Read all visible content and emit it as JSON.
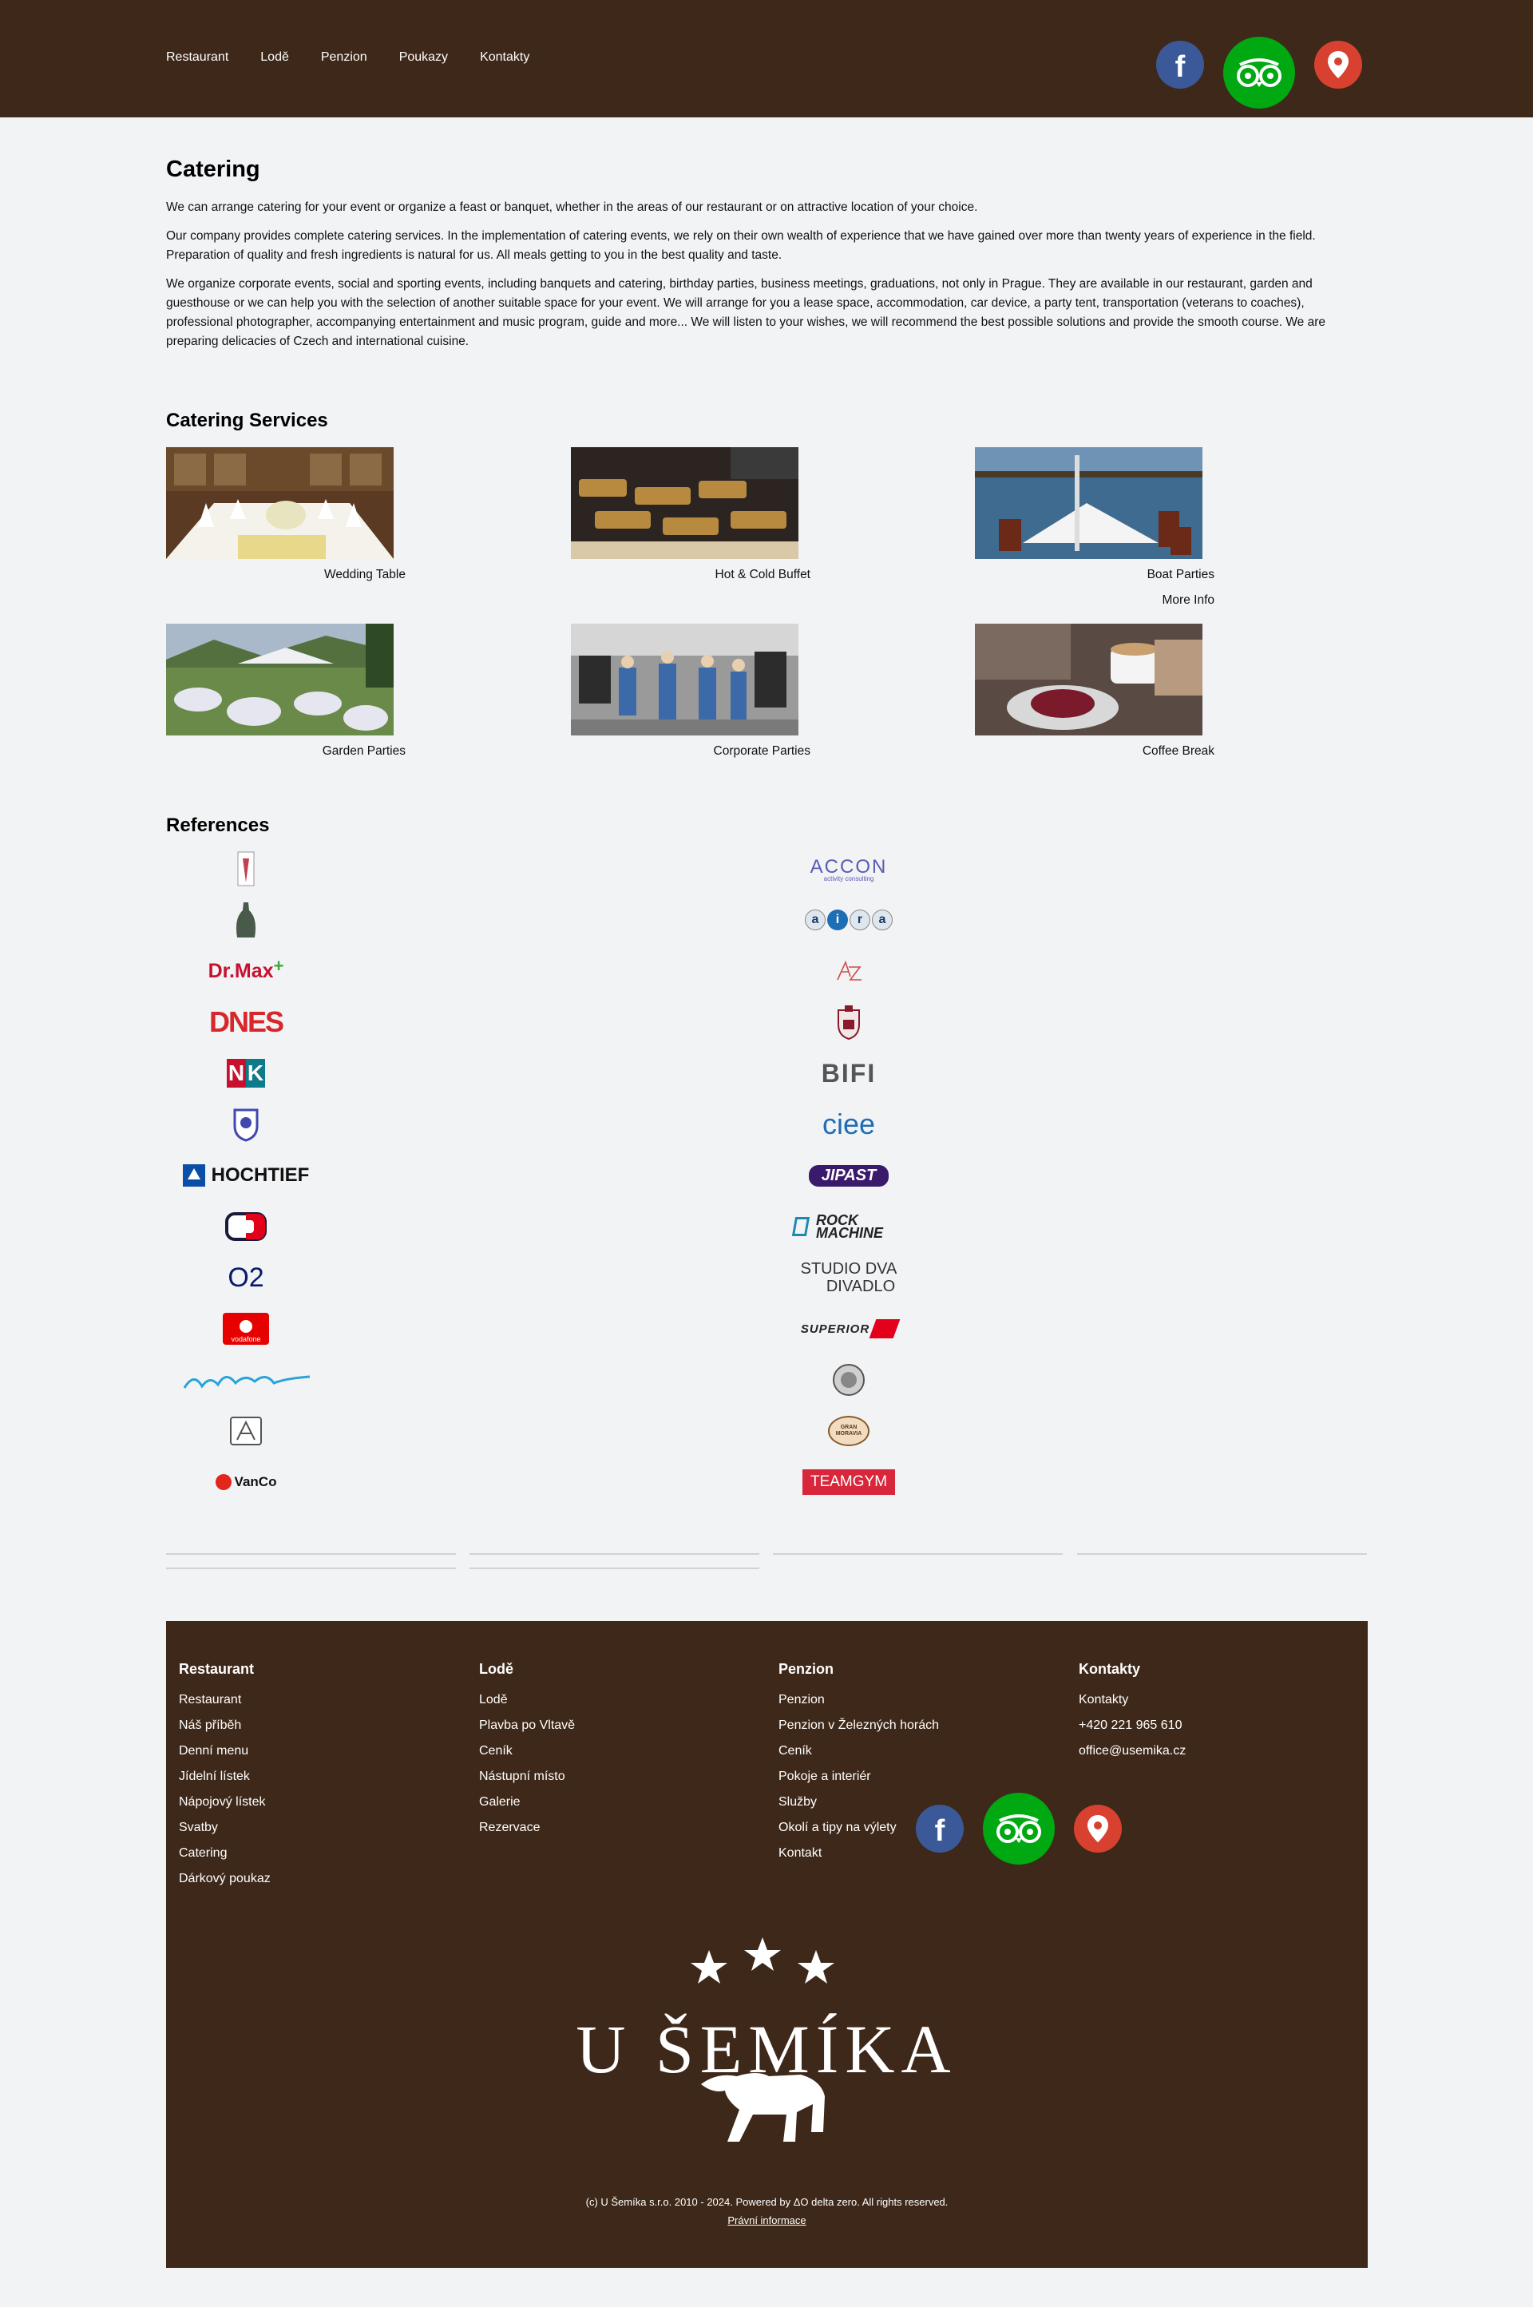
{
  "nav": {
    "items": [
      "Restaurant",
      "Lodě",
      "Penzion",
      "Poukazy",
      "Kontakty"
    ]
  },
  "social": {
    "facebook_letter": "f",
    "icons": [
      "facebook-icon",
      "tripadvisor-icon",
      "map-pin-icon"
    ],
    "colors": {
      "facebook": "#3b5998",
      "tripadvisor": "#00a811",
      "map": "#d8412f"
    }
  },
  "intro": {
    "title": "Catering",
    "paragraphs": [
      "We can arrange catering for your event or organize a feast or banquet, whether in the areas of our restaurant or on attractive location of your choice.",
      "Our company provides complete catering services. In the implementation of catering events, we rely on their own wealth of experience that we have gained over more than twenty years of experience in the field. Preparation of quality and fresh ingredients is natural for us. All meals getting to you in the best quality and taste.",
      "We organize corporate events, social and sporting events, including banquets and catering, birthday parties, business meetings, graduations, not only in Prague. They are available in our restaurant, garden and guesthouse or we can help you with the selection of another suitable space for your event. We will arrange for you a lease space, accommodation, car device, a party tent, transportation (veterans to coaches), professional photographer, accompanying entertainment and music program, guide and more... We will listen to your wishes, we will recommend the best possible solutions and provide the smooth course. We are preparing delicacies of Czech and international cuisine."
    ]
  },
  "services": {
    "title": "Catering Services",
    "items": [
      {
        "label": "Wedding Table"
      },
      {
        "label": "Hot & Cold Buffet"
      },
      {
        "label": "Boat Parties",
        "more": "More Info"
      },
      {
        "label": "Garden Parties"
      },
      {
        "label": "Corporate Parties"
      },
      {
        "label": "Coffee Break"
      }
    ]
  },
  "references": {
    "title": "References",
    "logos_left": [
      {
        "text": ""
      },
      {
        "text": ""
      },
      {
        "text": "Dr.Max"
      },
      {
        "text": "DNES"
      },
      {
        "text": "NK"
      },
      {
        "text": ""
      },
      {
        "text": "HOCHTIEF"
      },
      {
        "text": ""
      },
      {
        "text": "O2"
      },
      {
        "text": "vodafone"
      },
      {
        "text": ""
      },
      {
        "text": ""
      },
      {
        "text": "VanCo"
      }
    ],
    "logos_right": [
      {
        "text": "ACCON",
        "sub": "activity consulting"
      },
      {
        "text": "airia"
      },
      {
        "text": ""
      },
      {
        "text": ""
      },
      {
        "text": "BIFI"
      },
      {
        "text": "ciee"
      },
      {
        "text": "JIPAST"
      },
      {
        "text": "ROCK MACHINE"
      },
      {
        "text": "STUDIO DVA",
        "sub": "DIVADLO"
      },
      {
        "text": "SUPERIOR"
      },
      {
        "text": ""
      },
      {
        "text": "GRAN MORAVIA"
      },
      {
        "text": "TEAMGYM"
      }
    ]
  },
  "footer": {
    "columns": [
      {
        "title": "Restaurant",
        "links": [
          "Restaurant",
          "Náš příběh",
          "Denní menu",
          "Jídelní lístek",
          "Nápojový lístek",
          "Svatby",
          "Catering",
          "Dárkový poukaz"
        ]
      },
      {
        "title": "Lodě",
        "links": [
          "Lodě",
          "Plavba po Vltavě",
          "Ceník",
          "Nástupní místo",
          "Galerie",
          "Rezervace"
        ]
      },
      {
        "title": "Penzion",
        "links": [
          "Penzion",
          "Penzion v Železných horách",
          "Ceník",
          "Pokoje a interiér",
          "Služby",
          "Okolí a tipy na výlety",
          "Kontakt"
        ]
      },
      {
        "title": "Kontakty",
        "links": [
          "Kontakty",
          "+420 221 965 610",
          "office@usemika.cz"
        ]
      }
    ],
    "brand": "U ŠEMÍKA",
    "copyright": "(c) U Šemíka s.r.o. 2010 - 2024. Powered by ΔO delta zero. All rights reserved.",
    "legal": "Právní informace"
  }
}
